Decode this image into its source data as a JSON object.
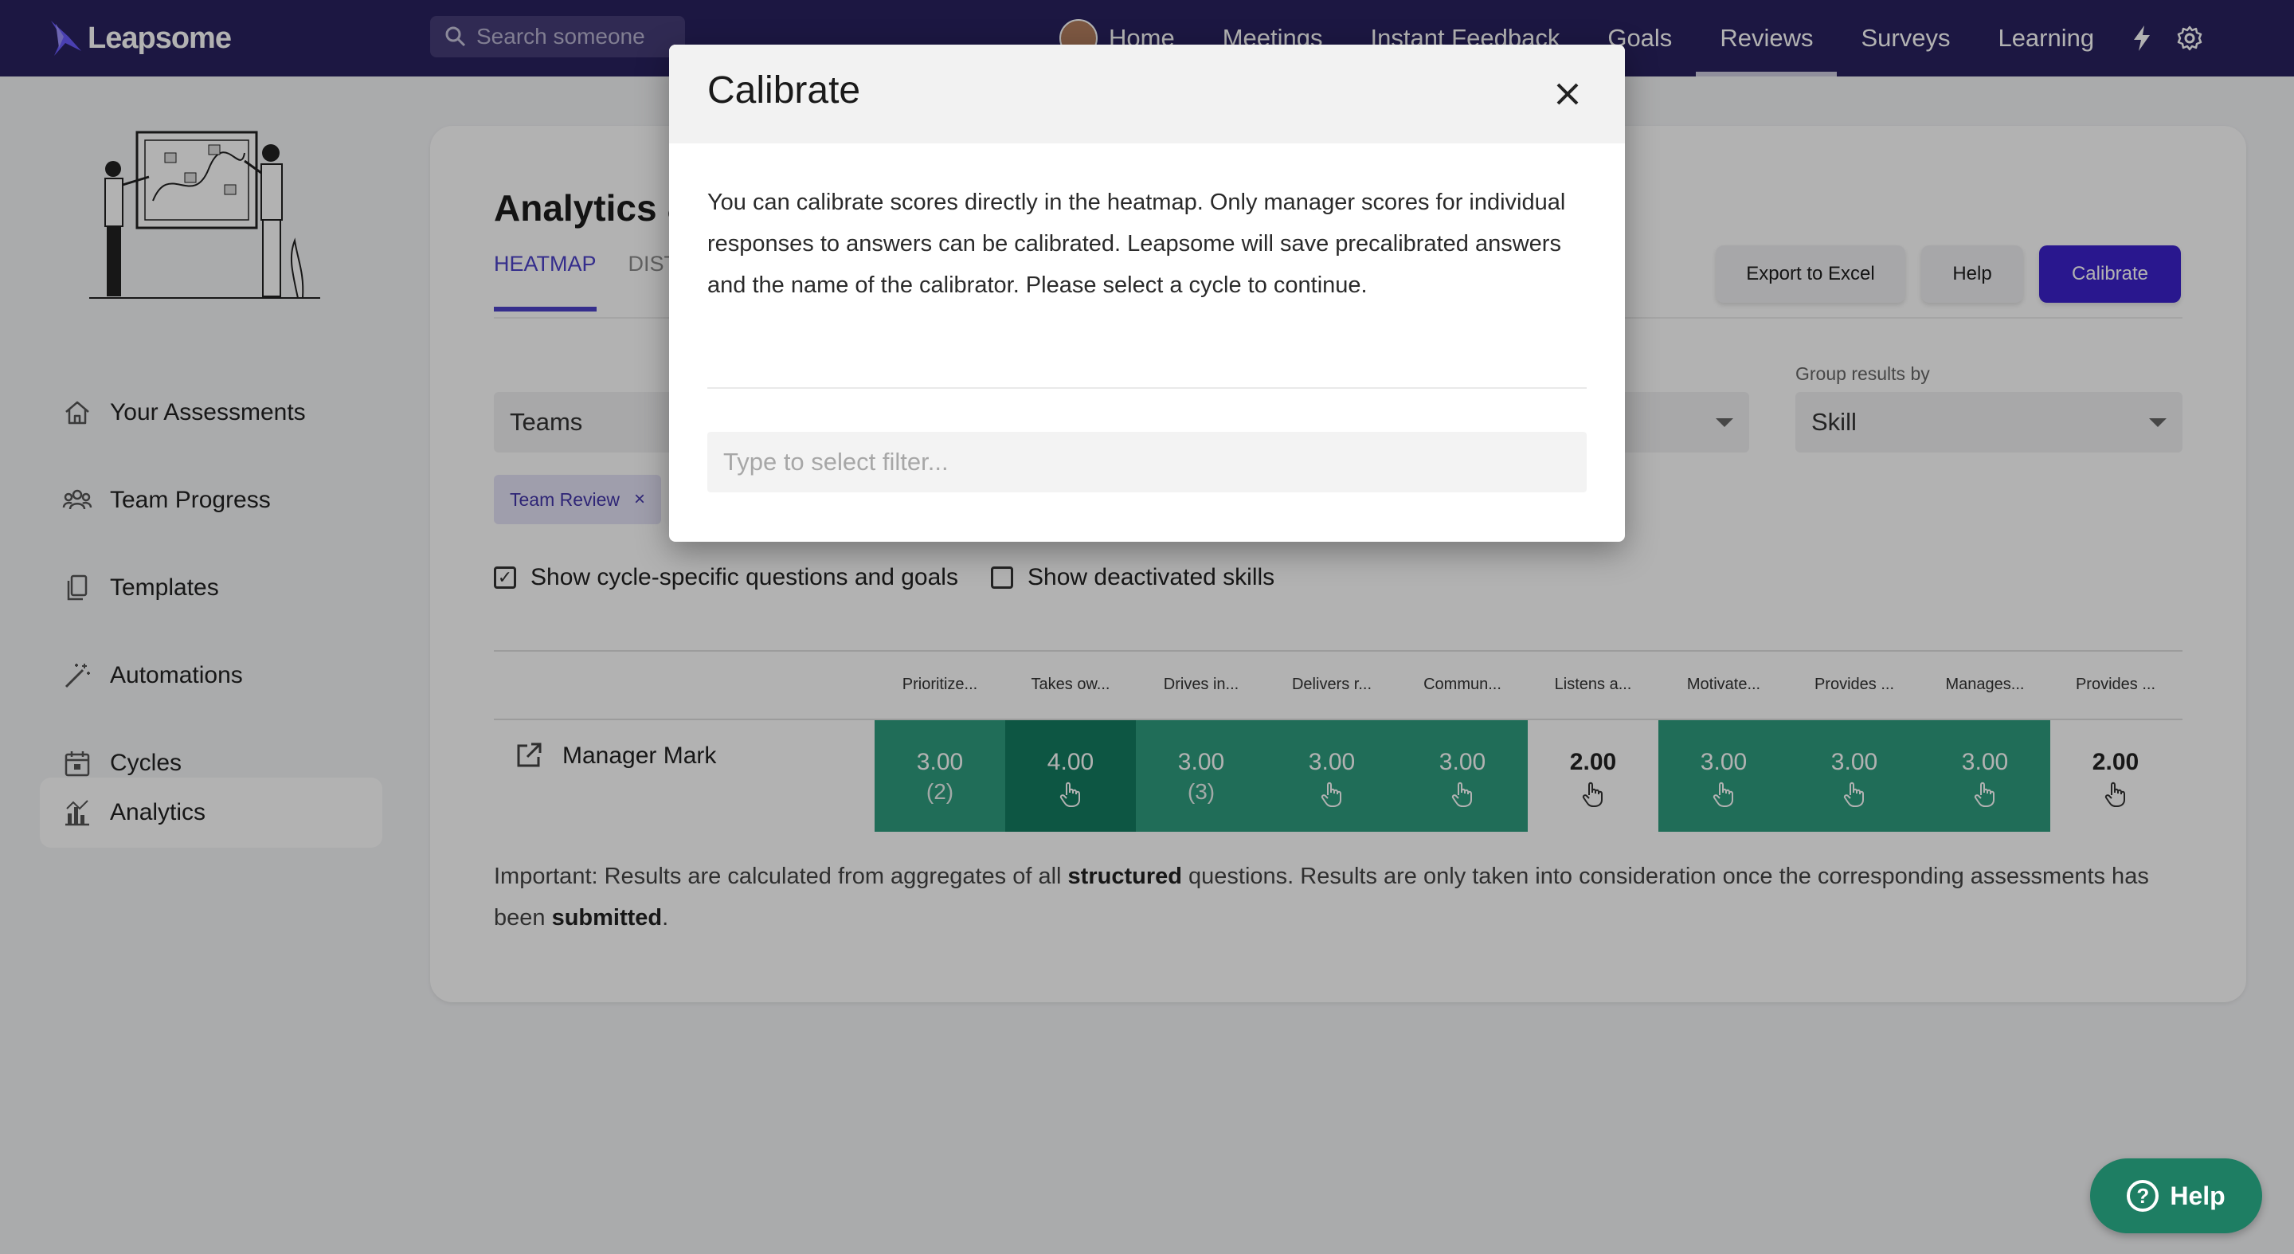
{
  "brand": {
    "name": "Leapsome"
  },
  "search": {
    "placeholder": "Search someone"
  },
  "nav": {
    "items": [
      {
        "label": "Home"
      },
      {
        "label": "Meetings"
      },
      {
        "label": "Instant Feedback"
      },
      {
        "label": "Goals"
      },
      {
        "label": "Reviews",
        "active": true
      },
      {
        "label": "Surveys"
      },
      {
        "label": "Learning"
      }
    ],
    "icons": [
      "lightning-icon",
      "gear-icon"
    ]
  },
  "sidebar": {
    "items": [
      {
        "label": "Your Assessments",
        "icon": "home-icon"
      },
      {
        "label": "Team Progress",
        "icon": "people-icon"
      },
      {
        "label": "Templates",
        "icon": "copy-icon"
      },
      {
        "label": "Automations",
        "icon": "magic-wand-icon"
      },
      {
        "label": "Cycles",
        "icon": "calendar-icon"
      },
      {
        "label": "Analytics",
        "icon": "bar-chart-icon",
        "active": true
      }
    ]
  },
  "main": {
    "title": "Analytics &",
    "tabs": [
      {
        "label": "HEATMAP",
        "active": true
      },
      {
        "label": "DIST"
      }
    ],
    "actions": {
      "export": "Export to Excel",
      "help": "Help",
      "calibrate": "Calibrate"
    },
    "filters": {
      "teams_value": "Teams",
      "group_label": "Group results by",
      "group_value": "Skill",
      "chip": "Team Review",
      "chip_remove": "×"
    },
    "checkboxes": [
      {
        "label": "Show cycle-specific questions and goals",
        "checked": true,
        "mark": "✓"
      },
      {
        "label": "Show deactivated skills",
        "checked": false,
        "mark": ""
      }
    ],
    "heatmap": {
      "columns": [
        "Prioritize...",
        "Takes ow...",
        "Drives in...",
        "Delivers r...",
        "Commun...",
        "Listens a...",
        "Motivate...",
        "Provides ...",
        "Manages...",
        "Provides ..."
      ],
      "rows": [
        {
          "name": "Manager Mark",
          "cells": [
            {
              "value": "3.00",
              "sub": "(2)",
              "shade": "mid"
            },
            {
              "value": "4.00",
              "sub": "",
              "shade": "dark"
            },
            {
              "value": "3.00",
              "sub": "(3)",
              "shade": "mid"
            },
            {
              "value": "3.00",
              "sub": "",
              "shade": "mid"
            },
            {
              "value": "3.00",
              "sub": "",
              "shade": "mid"
            },
            {
              "value": "2.00",
              "sub": "",
              "shade": "none"
            },
            {
              "value": "3.00",
              "sub": "",
              "shade": "mid"
            },
            {
              "value": "3.00",
              "sub": "",
              "shade": "mid"
            },
            {
              "value": "3.00",
              "sub": "",
              "shade": "mid"
            },
            {
              "value": "2.00",
              "sub": "",
              "shade": "none"
            }
          ]
        }
      ]
    },
    "footnote": {
      "p1": "Important: Results are calculated from aggregates of all ",
      "b1": "structured",
      "p2": " questions. Results are only taken into consideration once the corresponding assessments has been ",
      "b2": "submitted",
      "p3": "."
    }
  },
  "modal": {
    "title": "Calibrate",
    "text": "You can calibrate scores directly in the heatmap. Only manager scores for individual responses to answers can be calibrated. Leapsome will save precalibrated answers and the name of the calibrator. Please select a cycle to continue.",
    "input_placeholder": "Type to select filter..."
  },
  "help_widget": {
    "label": "Help",
    "glyph": "?"
  },
  "colors": {
    "nav_bg": "#29215f",
    "accent": "#3b22cc",
    "heat_mid": "#2f9d7e",
    "heat_dark": "#137b60",
    "help_bg": "#1e7e63"
  }
}
